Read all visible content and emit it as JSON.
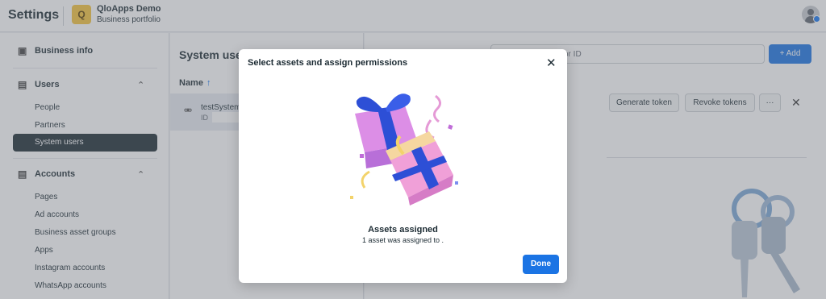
{
  "topbar": {
    "title": "Settings",
    "business_initial": "Q",
    "business_name": "QloApps Demo",
    "business_sub": "Business portfolio"
  },
  "sidebar": {
    "business_info": "Business info",
    "users": "Users",
    "users_items": [
      "People",
      "Partners",
      "System users"
    ],
    "accounts": "Accounts",
    "accounts_items": [
      "Pages",
      "Ad accounts",
      "Business asset groups",
      "Apps",
      "Instagram accounts",
      "WhatsApp accounts"
    ]
  },
  "main": {
    "panel_title": "System use",
    "name_header": "Name",
    "sort_arrow": "↑",
    "row_name": "testSystem",
    "row_id": "ID",
    "search_placeholder": "or ID",
    "add_label": "+ Add",
    "generate_token": "Generate token",
    "revoke_tokens": "Revoke tokens",
    "more": "···"
  },
  "modal": {
    "title": "Select assets and assign permissions",
    "assigned_title": "Assets assigned",
    "assigned_sub": "1 asset was assigned to .",
    "done_label": "Done"
  },
  "colors": {
    "primary": "#1b74e4",
    "dark": "#1c2b33",
    "overlay": "rgba(105,110,120,0.42)"
  }
}
